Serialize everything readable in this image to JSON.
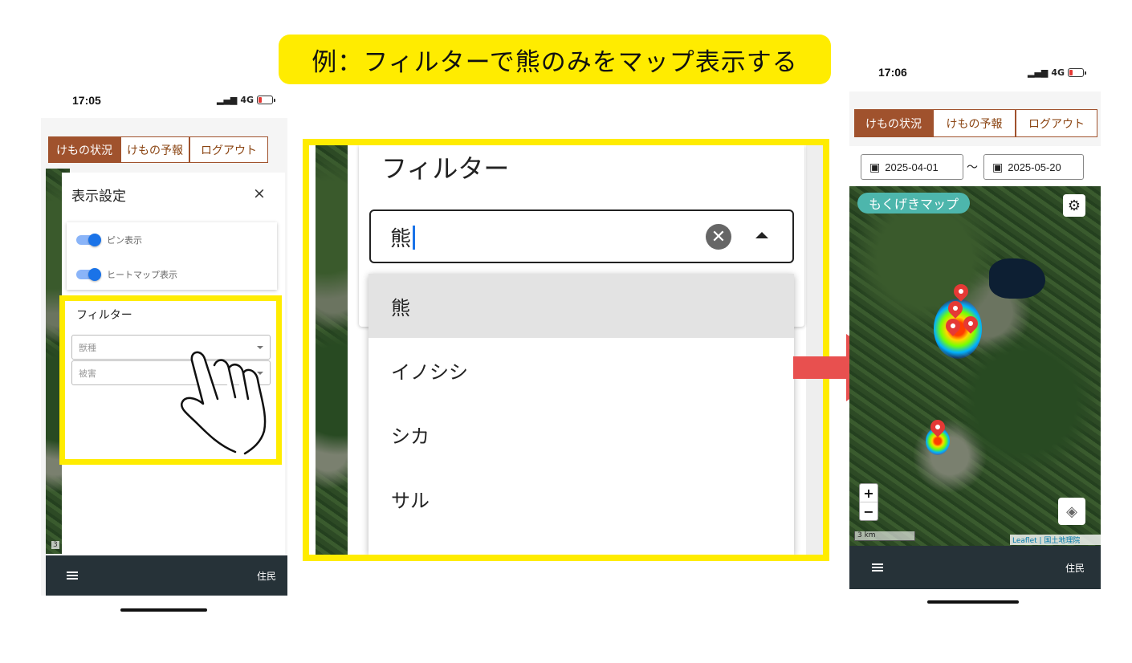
{
  "caption": "例：フィルターで熊のみをマップ表示する",
  "left": {
    "time": "17:05",
    "network": "4G",
    "tabs": [
      "けもの状況",
      "けもの予報",
      "ログアウト"
    ],
    "panel_title": "表示設定",
    "close": "×",
    "toggles": [
      "ピン表示",
      "ヒートマップ表示"
    ],
    "filter_title": "フィルター",
    "filter_selects": [
      "獣種",
      "被害"
    ],
    "scale_fragment": "3",
    "user_label": "住民"
  },
  "middle": {
    "filter_title": "フィルター",
    "input_value": "熊",
    "options": [
      "熊",
      "イノシシ",
      "シカ",
      "サル"
    ]
  },
  "right": {
    "time": "17:06",
    "network": "4G",
    "tabs": [
      "けもの状況",
      "けもの予報",
      "ログアウト"
    ],
    "date_from": "2025-04-01",
    "date_sep": "〜",
    "date_to": "2025-05-20",
    "map_label": "もくげきマップ",
    "zoom_in": "+",
    "zoom_out": "−",
    "scale": "3 km",
    "attribution": "Leaflet | 国土地理院",
    "user_label": "住民"
  },
  "colors": {
    "highlight": "#ffec00",
    "brand_brown": "#a0522d",
    "arrow_red": "#e8504f",
    "toggle_blue": "#1a73e8",
    "bar_dark": "#263238",
    "map_label_teal": "#4db6ac"
  }
}
